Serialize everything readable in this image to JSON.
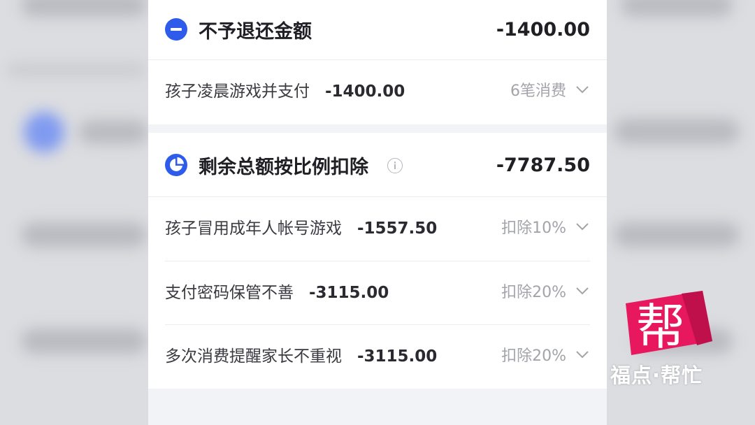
{
  "section1": {
    "title": "不予退还金额",
    "amount": "-1400.00",
    "items": [
      {
        "label": "孩子凌晨游戏并支付",
        "amount": "-1400.00",
        "detail": "6笔消费"
      }
    ]
  },
  "section2": {
    "title": "剩余总额按比例扣除",
    "amount": "-7787.50",
    "items": [
      {
        "label": "孩子冒用成年人帐号游戏",
        "amount": "-1557.50",
        "detail": "扣除10%"
      },
      {
        "label": "支付密码保管不善",
        "amount": "-3115.00",
        "detail": "扣除20%"
      },
      {
        "label": "多次消费提醒家长不重视",
        "amount": "-3115.00",
        "detail": "扣除20%"
      }
    ]
  },
  "watermark": {
    "logo_char": "帮",
    "caption": "福点·帮忙"
  },
  "colors": {
    "accent_blue": "#2f5bea",
    "logo_pink": "#e8185e"
  },
  "icons": {
    "section1": "minus-circle-icon",
    "section2": "pie-chart-icon",
    "info": "info-icon",
    "chevron": "chevron-down-icon"
  }
}
